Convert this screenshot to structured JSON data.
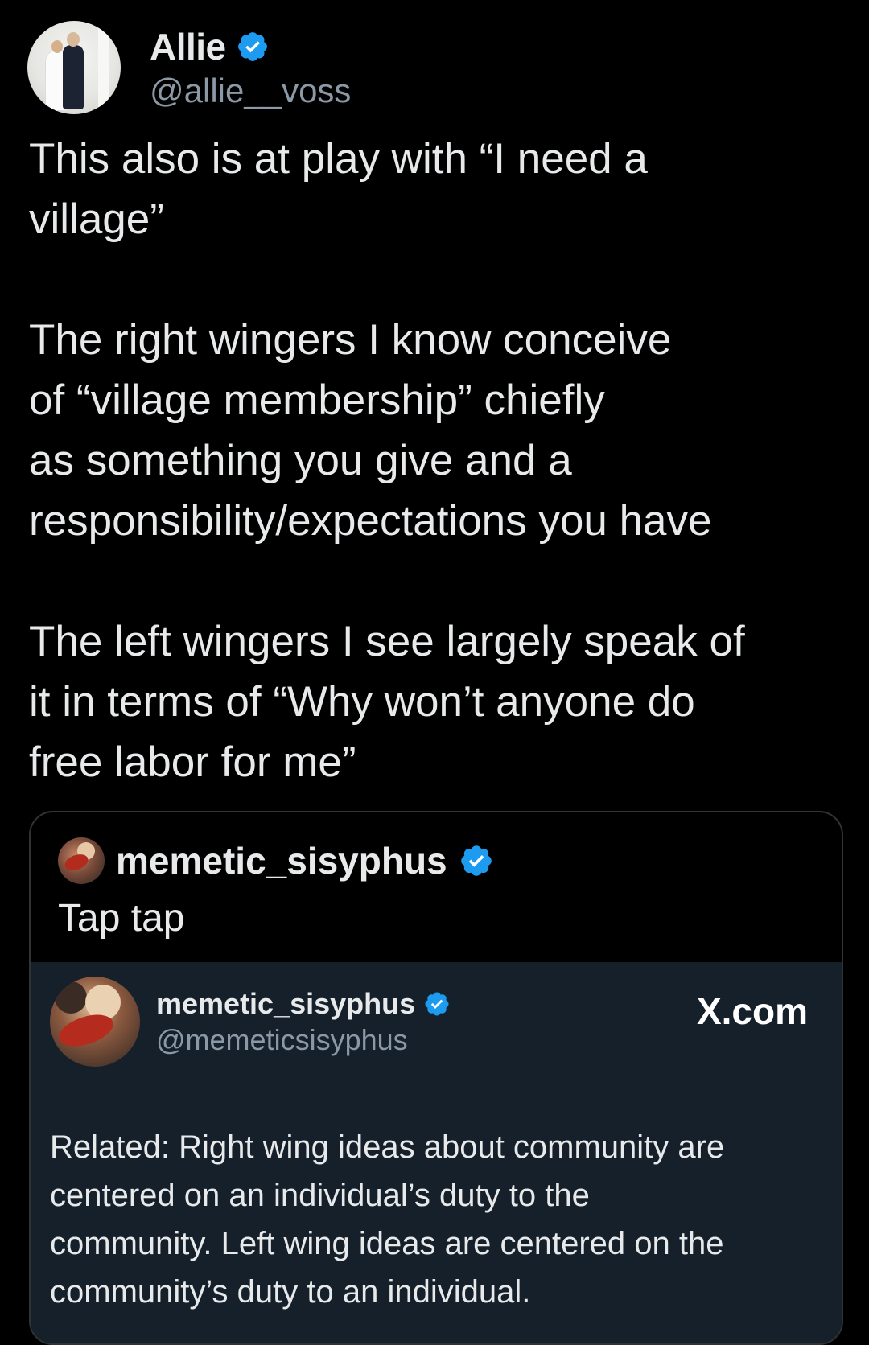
{
  "author": {
    "display_name": "Allie",
    "handle": "@allie__voss",
    "verified": true
  },
  "tweet": {
    "text": "This also is at play with “I need a\nvillage”\n\nThe right wingers I know conceive\nof “village membership” chiefly\nas something you give and a\nresponsibility/expectations you have\n\nThe left wingers I see largely speak of\nit in terms of “Why won’t anyone do\nfree labor for me”"
  },
  "quote": {
    "display_name": "memetic_sisyphus",
    "verified": true,
    "text": "Tap tap",
    "embed": {
      "display_name": "memetic_sisyphus",
      "handle": "@memeticsisyphus",
      "verified": true,
      "source": "X.com",
      "text": "Related: Right wing ideas about community are\ncentered on an individual’s duty to the\ncommunity. Left wing ideas are centered on the\ncommunity’s duty to an individual."
    }
  },
  "colors": {
    "background": "#000000",
    "text_primary": "#e7e9ea",
    "text_secondary": "#8b98a5",
    "verified_badge": "#1d9bf0",
    "embed_background": "#15202b",
    "border": "#2f3336"
  },
  "icons": {
    "verified": "verified-badge-icon"
  }
}
